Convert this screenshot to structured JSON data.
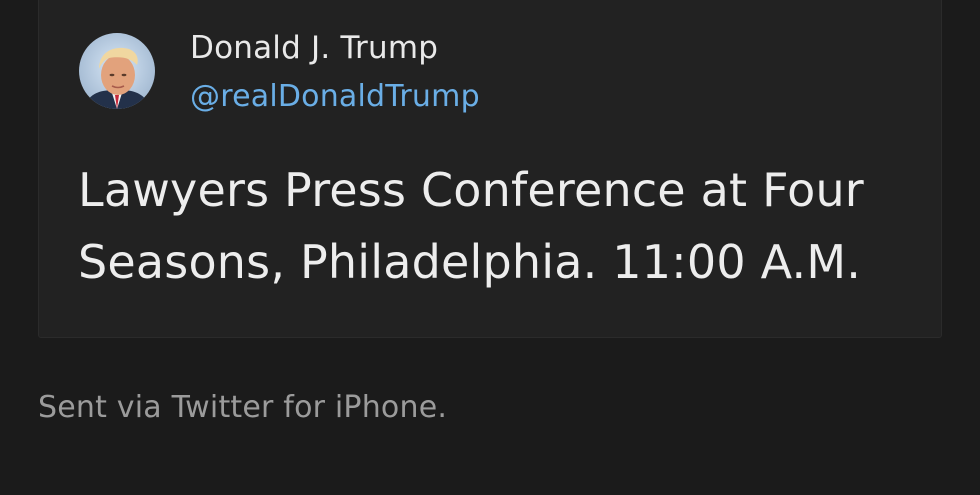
{
  "tweet": {
    "author": {
      "display_name": "Donald J. Trump",
      "handle": "@realDonaldTrump",
      "avatar_icon": "profile-photo"
    },
    "text": "Lawyers Press Conference at Four Seasons, Philadelphia. 11:00 A.M."
  },
  "footer": {
    "note": "Sent via Twitter for iPhone."
  },
  "colors": {
    "background": "#1b1b1b",
    "card": "#222222",
    "handle": "#6aaee6",
    "text": "#ededed",
    "muted": "#9b9b9b"
  }
}
